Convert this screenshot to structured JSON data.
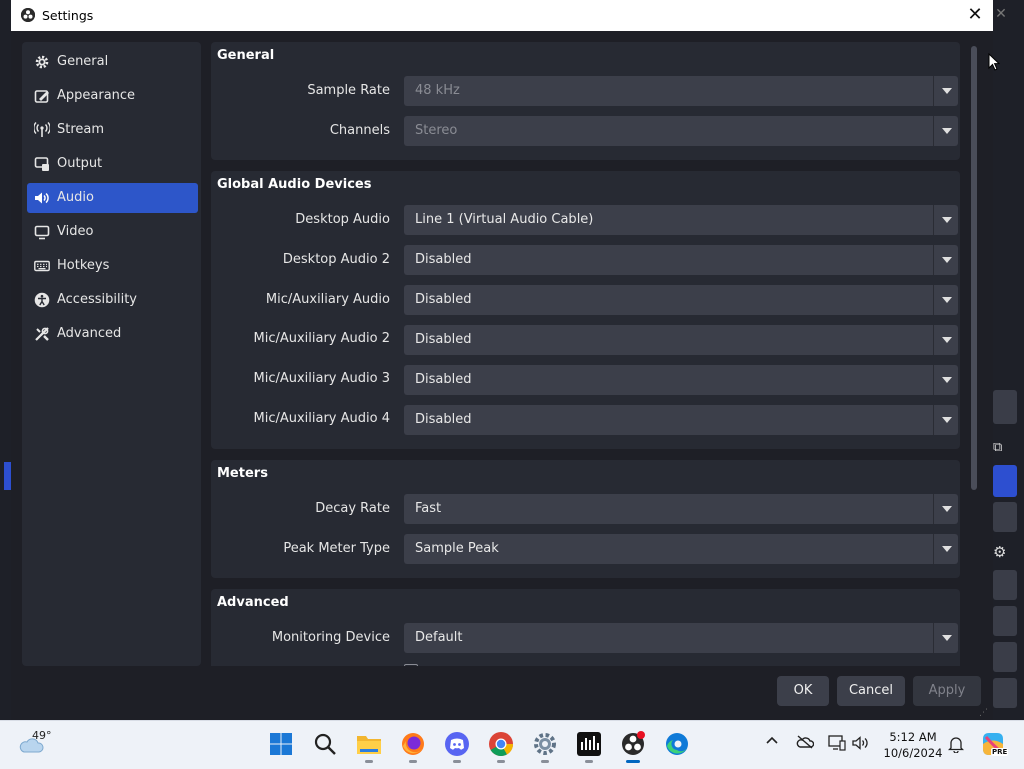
{
  "window": {
    "title": "Settings",
    "close_symbol": "✕"
  },
  "nav": [
    {
      "label": "General",
      "icon": "gear-icon",
      "active": false
    },
    {
      "label": "Appearance",
      "icon": "appearance-icon",
      "active": false
    },
    {
      "label": "Stream",
      "icon": "antenna-icon",
      "active": false
    },
    {
      "label": "Output",
      "icon": "output-icon",
      "active": false
    },
    {
      "label": "Audio",
      "icon": "speaker-icon",
      "active": true
    },
    {
      "label": "Video",
      "icon": "monitor-icon",
      "active": false
    },
    {
      "label": "Hotkeys",
      "icon": "keyboard-icon",
      "active": false
    },
    {
      "label": "Accessibility",
      "icon": "accessibility-icon",
      "active": false
    },
    {
      "label": "Advanced",
      "icon": "wrench-icon",
      "active": false
    }
  ],
  "groups": {
    "general": {
      "title": "General",
      "sample_rate": {
        "label": "Sample Rate",
        "value": "48 kHz"
      },
      "channels": {
        "label": "Channels",
        "value": "Stereo"
      }
    },
    "global_audio": {
      "title": "Global Audio Devices",
      "desktop_audio": {
        "label": "Desktop Audio",
        "value": "Line 1 (Virtual Audio Cable)"
      },
      "desktop_audio_2": {
        "label": "Desktop Audio 2",
        "value": "Disabled"
      },
      "mic_aux": {
        "label": "Mic/Auxiliary Audio",
        "value": "Disabled"
      },
      "mic_aux_2": {
        "label": "Mic/Auxiliary Audio 2",
        "value": "Disabled"
      },
      "mic_aux_3": {
        "label": "Mic/Auxiliary Audio 3",
        "value": "Disabled"
      },
      "mic_aux_4": {
        "label": "Mic/Auxiliary Audio 4",
        "value": "Disabled"
      }
    },
    "meters": {
      "title": "Meters",
      "decay_rate": {
        "label": "Decay Rate",
        "value": "Fast"
      },
      "peak_meter_type": {
        "label": "Peak Meter Type",
        "value": "Sample Peak"
      }
    },
    "advanced": {
      "title": "Advanced",
      "monitoring_device": {
        "label": "Monitoring Device",
        "value": "Default"
      }
    }
  },
  "buttons": {
    "ok": "OK",
    "cancel": "Cancel",
    "apply": "Apply"
  },
  "colors": {
    "accent": "#2d56c9",
    "dialog_bg": "#1e1f26",
    "panel_bg": "#272a33",
    "combo_bg": "#3c3f4a"
  },
  "taskbar": {
    "weather_temp": "49°",
    "time": "5:12 AM",
    "date": "10/6/2024",
    "apps": [
      "windows-start-icon",
      "search-icon",
      "file-explorer-icon",
      "firefox-icon",
      "discord-icon",
      "chrome-icon",
      "settings-icon",
      "audio-app-icon",
      "obs-icon",
      "edge-icon"
    ],
    "copilot_badge": "PRE"
  }
}
